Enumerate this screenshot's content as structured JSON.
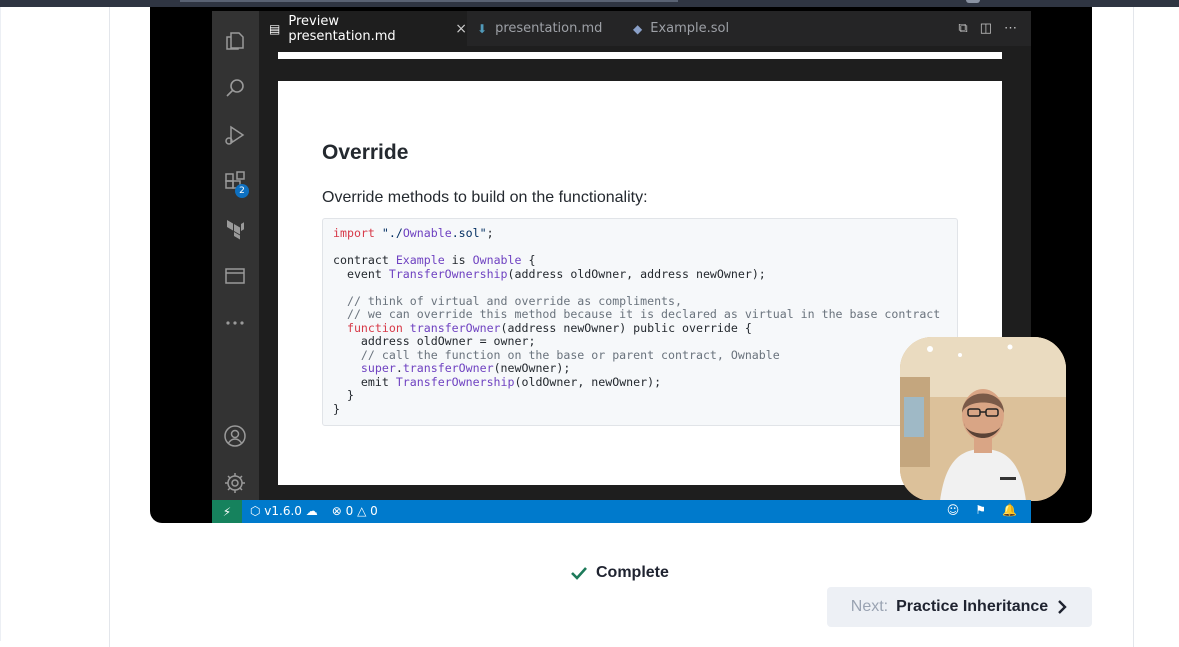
{
  "video": {
    "tabs": [
      {
        "label": "Preview presentation.md",
        "icon": "preview-icon",
        "active": true,
        "close": "×"
      },
      {
        "label": "presentation.md",
        "icon": "markdown-icon",
        "active": false
      },
      {
        "label": "Example.sol",
        "icon": "solidity-icon",
        "active": false
      }
    ],
    "activity_badge": "2",
    "slide": {
      "title": "Override",
      "subtitle": "Override methods to build on the functionality:",
      "code": [
        "import \"./Ownable.sol\";",
        "",
        "contract Example is Ownable {",
        "  event TransferOwnership(address oldOwner, address newOwner);",
        "",
        "  // think of virtual and override as compliments,",
        "  // we can override this method because it is declared as virtual in the base contract",
        "  function transferOwner(address newOwner) public override {",
        "    address oldOwner = owner;",
        "    // call the function on the base or parent contract, Ownable",
        "    super.transferOwner(newOwner);",
        "    emit TransferOwnership(oldOwner, newOwner);",
        "  }",
        "}"
      ]
    },
    "statusbar": {
      "version": "v1.6.0",
      "errors": "0",
      "warnings": "0"
    }
  },
  "lesson": {
    "complete_label": "Complete",
    "next_prefix": "Next:",
    "next_title": "Practice Inheritance"
  }
}
